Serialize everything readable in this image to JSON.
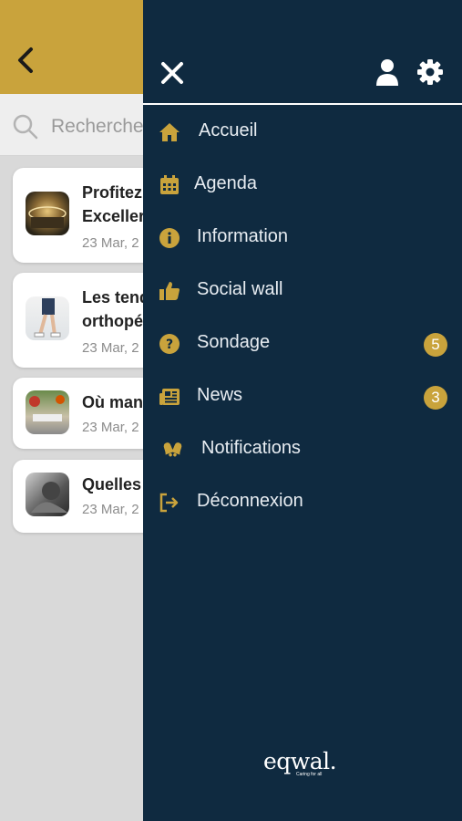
{
  "colors": {
    "brand_gold": "#c9a33c",
    "drawer_bg": "#0f2a40"
  },
  "search": {
    "placeholder": "Rechercher"
  },
  "articles": [
    {
      "title": "Profitez\nExceller",
      "date": "23 Mar, 2"
    },
    {
      "title": "Les tend\northopé",
      "date": "23 Mar, 2"
    },
    {
      "title": "Où man",
      "date": "23 Mar, 2"
    },
    {
      "title": "Quelles",
      "date": "23 Mar, 2"
    }
  ],
  "drawer": {
    "menu": [
      {
        "label": "Accueil",
        "icon": "home-icon"
      },
      {
        "label": "Agenda",
        "icon": "calendar-icon"
      },
      {
        "label": "Information",
        "icon": "info-icon"
      },
      {
        "label": "Social wall",
        "icon": "thumbs-up-icon"
      },
      {
        "label": "Sondage",
        "icon": "question-icon",
        "badge": "5"
      },
      {
        "label": "News",
        "icon": "newspaper-icon",
        "badge": "3"
      },
      {
        "label": "Notifications",
        "icon": "bell-icon"
      },
      {
        "label": "Déconnexion",
        "icon": "logout-icon"
      }
    ],
    "brand": {
      "name": "eqwal.",
      "tagline": "Caring for all"
    }
  }
}
